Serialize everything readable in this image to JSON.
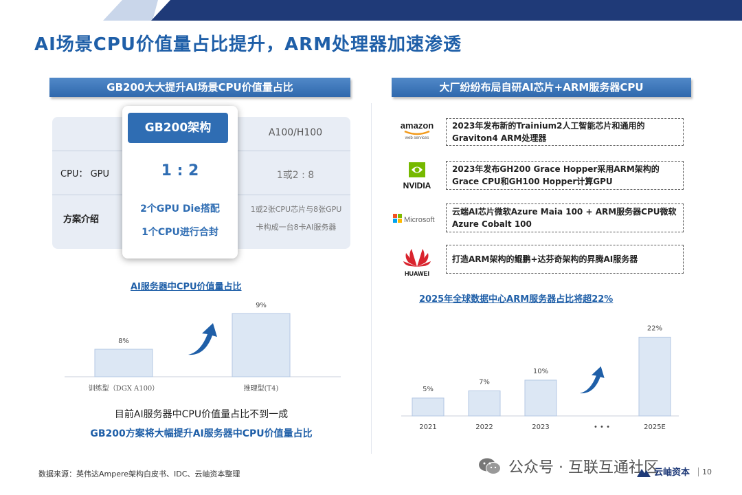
{
  "title": "AI场景CPU价值量占比提升，ARM处理器加速渗透",
  "left": {
    "header": "GB200大大提升AI场景CPU价值量占比",
    "table": {
      "col_gb200": "GB200架构",
      "col_a100": "A100/H100",
      "row1_label": "CPU：  GPU",
      "row1_gb200": "1 : 2",
      "row1_a100": "1或2 : 8",
      "row2_label": "方案介绍",
      "row2_gb200_line1": "2个GPU Die搭配",
      "row2_gb200_line2": "1个CPU进行合封",
      "row2_a100_line1": "1或2张CPU芯片与8张GPU",
      "row2_a100_line2": "卡构成一台8卡AI服务器"
    },
    "chart_title": "AI服务器中CPU价值量占比",
    "note1": "目前AI服务器中CPU价值量占比不到一成",
    "note2": "GB200方案将大幅提升AI服务器中CPU价值量占比"
  },
  "right": {
    "header": "大厂纷纷布局自研AI芯片+ARM服务器CPU",
    "companies": [
      {
        "logo": "amazon",
        "logo_sub": "web services",
        "icon": "amazon-logo-icon",
        "desc": "2023年发布新的Trainium2人工智能芯片和通用的Graviton4 ARM处理器"
      },
      {
        "logo": "NVIDIA",
        "icon": "nvidia-logo-icon",
        "desc": "2023年发布GH200 Grace Hopper采用ARM架构的Grace CPU和GH100 Hopper计算GPU"
      },
      {
        "logo": "Microsoft",
        "icon": "microsoft-logo-icon",
        "desc": "云端AI芯片微软Azure Maia 100 + ARM服务器CPU微软Azure Cobalt 100"
      },
      {
        "logo": "HUAWEI",
        "icon": "huawei-logo-icon",
        "desc": "打造ARM架构的鲲鹏+达芬奇架构的昇腾AI服务器"
      }
    ],
    "chart_title": "2025年全球数据中心ARM服务器占比将超22%",
    "ellipsis": "• • •"
  },
  "footer": {
    "source": "数据来源：英伟达Ampere架构白皮书、IDC、云岫资本整理",
    "wechat": "公众号 · 互联互通社区",
    "brand": "云岫资本",
    "page": "10"
  },
  "chart_data": [
    {
      "type": "bar",
      "title": "AI服务器中CPU价值量占比",
      "categories": [
        "训练型（DGX A100）",
        "推理型(T4)"
      ],
      "values": [
        8,
        9
      ],
      "value_labels": [
        "8%",
        "9%"
      ],
      "ylim": [
        0,
        10
      ]
    },
    {
      "type": "bar",
      "title": "2025年全球数据中心ARM服务器占比将超22%",
      "categories": [
        "2021",
        "2022",
        "2023",
        "2025E"
      ],
      "values": [
        5,
        7,
        10,
        22
      ],
      "value_labels": [
        "5%",
        "7%",
        "10%",
        "22%"
      ],
      "ylim": [
        0,
        24
      ]
    }
  ],
  "colors": {
    "brand_blue": "#1f5fa8",
    "header_blue": "#2f68ad",
    "bar_fill": "#dce7f4",
    "bar_stroke": "#b3c7e3",
    "arrow": "#1f5fa8"
  }
}
